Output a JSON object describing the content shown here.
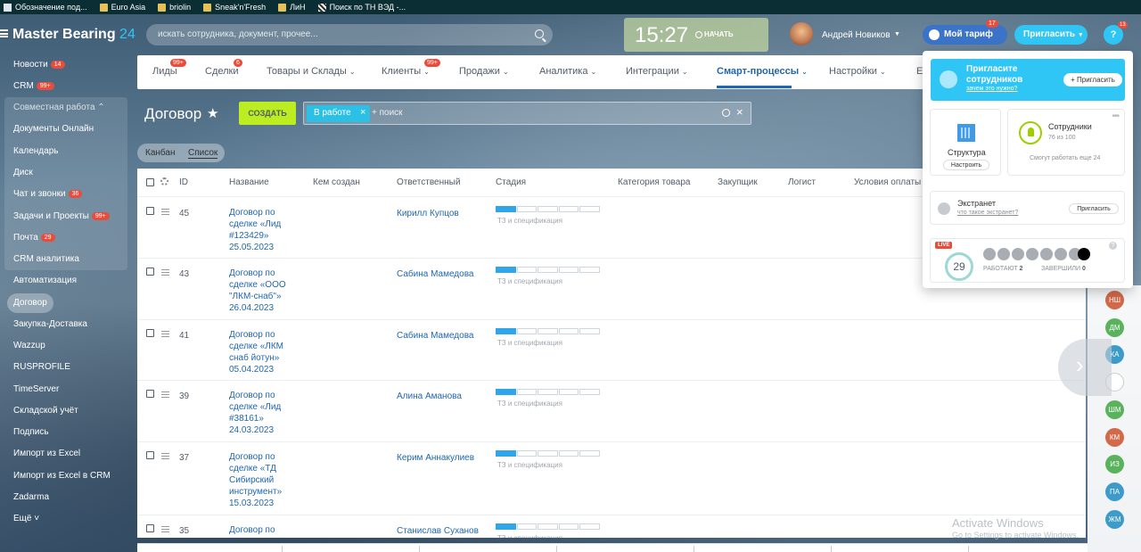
{
  "bookmarks": [
    {
      "label": "Обозначение под..."
    },
    {
      "label": "Euro Asia"
    },
    {
      "label": "briolin"
    },
    {
      "label": "Sneak'n'Fresh"
    },
    {
      "label": "ЛиН"
    },
    {
      "label": "Поиск по ТН ВЭД -..."
    }
  ],
  "header": {
    "logo_main": "Master Bearing",
    "logo_num": "24",
    "search_placeholder": "искать сотрудника, документ, прочее...",
    "clock": "15:27",
    "clock_label": "НАЧАТЬ",
    "user_name": "Андрей Новиков",
    "tariff_label": "Мой тариф",
    "tariff_badge": "17",
    "invite_label": "Пригласить",
    "help_label": "?",
    "help_badge": "13"
  },
  "sidebar": {
    "items": [
      {
        "label": "Новости",
        "badge": "14"
      },
      {
        "label": "CRM",
        "badge": "99+"
      },
      {
        "label": "Совместная работа ⌃"
      },
      {
        "label": "Документы Онлайн"
      },
      {
        "label": "Календарь"
      },
      {
        "label": "Диск"
      },
      {
        "label": "Чат и звонки",
        "badge": "36"
      },
      {
        "label": "Задачи и Проекты",
        "badge": "99+"
      },
      {
        "label": "Почта",
        "badge": "29"
      },
      {
        "label": "CRM аналитика"
      },
      {
        "label": "Автоматизация"
      },
      {
        "label": "Договор"
      },
      {
        "label": "Закупка-Доставка"
      },
      {
        "label": "Wazzup"
      },
      {
        "label": "RUSPROFILE"
      },
      {
        "label": "TimeServer"
      },
      {
        "label": "Складской учёт"
      },
      {
        "label": "Подпись"
      },
      {
        "label": "Импорт из Excel"
      },
      {
        "label": "Импорт из Excel в CRM"
      },
      {
        "label": "Zadarma"
      },
      {
        "label": "Ещё ˅"
      }
    ]
  },
  "nav": {
    "items": [
      {
        "label": "Лиды",
        "badge": "99+"
      },
      {
        "label": "Сделки",
        "badge": "6"
      },
      {
        "label": "Товары и Склады"
      },
      {
        "label": "Клиенты",
        "badge": "99+"
      },
      {
        "label": "Продажи"
      },
      {
        "label": "Аналитика"
      },
      {
        "label": "Интеграции"
      },
      {
        "label": "Смарт-процессы"
      },
      {
        "label": "Настройки"
      },
      {
        "label": "Е"
      }
    ]
  },
  "page": {
    "title": "Договор",
    "create_label": "СОЗДАТЬ",
    "filter_chip": "В работе",
    "filter_search": "+ поиск",
    "view_kanban": "Канбан",
    "view_list": "Список"
  },
  "table": {
    "headers": [
      "ID",
      "Название",
      "Кем создан",
      "Ответственный",
      "Стадия",
      "Категория товара",
      "Закупщик",
      "Логист",
      "Условия оплаты"
    ],
    "stage_label": "ТЗ и спецификация",
    "rows": [
      {
        "id": "45",
        "name": [
          "Договор по",
          "сделке «Лид",
          "#123429»",
          "25.05.2023"
        ],
        "resp": "Кирилл Купцов"
      },
      {
        "id": "43",
        "name": [
          "Договор по",
          "сделке «ООО",
          "\"ЛКМ-снаб\"»",
          "26.04.2023"
        ],
        "resp": "Сабина Мамедова"
      },
      {
        "id": "41",
        "name": [
          "Договор по",
          "сделке «ЛКМ",
          "снаб йотун»",
          "05.04.2023"
        ],
        "resp": "Сабина Мамедова"
      },
      {
        "id": "39",
        "name": [
          "Договор по",
          "сделке «Лид",
          "#38161»",
          "24.03.2023"
        ],
        "resp": "Алина Аманова"
      },
      {
        "id": "37",
        "name": [
          "Договор по",
          "сделке «ТД",
          "Сибирский",
          "инструмент»",
          "15.03.2023"
        ],
        "resp": "Керим Аннакулиев"
      },
      {
        "id": "35",
        "name": [
          "Договор по"
        ],
        "resp": "Станислав Суханов"
      }
    ]
  },
  "popup": {
    "head_title": "Пригласите сотрудников",
    "head_sub": "зачем это нужно?",
    "head_btn": "+ Пригласить",
    "structure_label": "Структура",
    "structure_btn": "Настроить",
    "employees_label": "Сотрудники",
    "employees_count": "76 из 100",
    "employees_note": "Смогут работать еще 24",
    "extranet_label": "Экстранет",
    "extranet_sub": "что такое экстранет?",
    "extranet_btn": "Пригласить",
    "live_badge": "LIVE",
    "live_count": "29",
    "working_label": "РАБОТАЮТ",
    "working_count": "2",
    "finished_label": "ЗАВЕРШИЛИ",
    "finished_count": "0"
  },
  "right_avatars": [
    {
      "initials": "НШ",
      "color": "#d2694a"
    },
    {
      "initials": "ДМ",
      "color": "#5bb25c"
    },
    {
      "initials": "КА",
      "color": "#3d9bc9"
    },
    {
      "initials": "",
      "color": "#ffffff"
    },
    {
      "initials": "ШМ",
      "color": "#5bb25c"
    },
    {
      "initials": "КМ",
      "color": "#d2694a"
    },
    {
      "initials": "ИЗ",
      "color": "#5bb25c"
    },
    {
      "initials": "ПА",
      "color": "#3d9bc9"
    },
    {
      "initials": "ЖМ",
      "color": "#3d9bc9"
    }
  ],
  "watermark": {
    "title": "Activate Windows",
    "sub": "Go to Settings to activate Windows."
  }
}
